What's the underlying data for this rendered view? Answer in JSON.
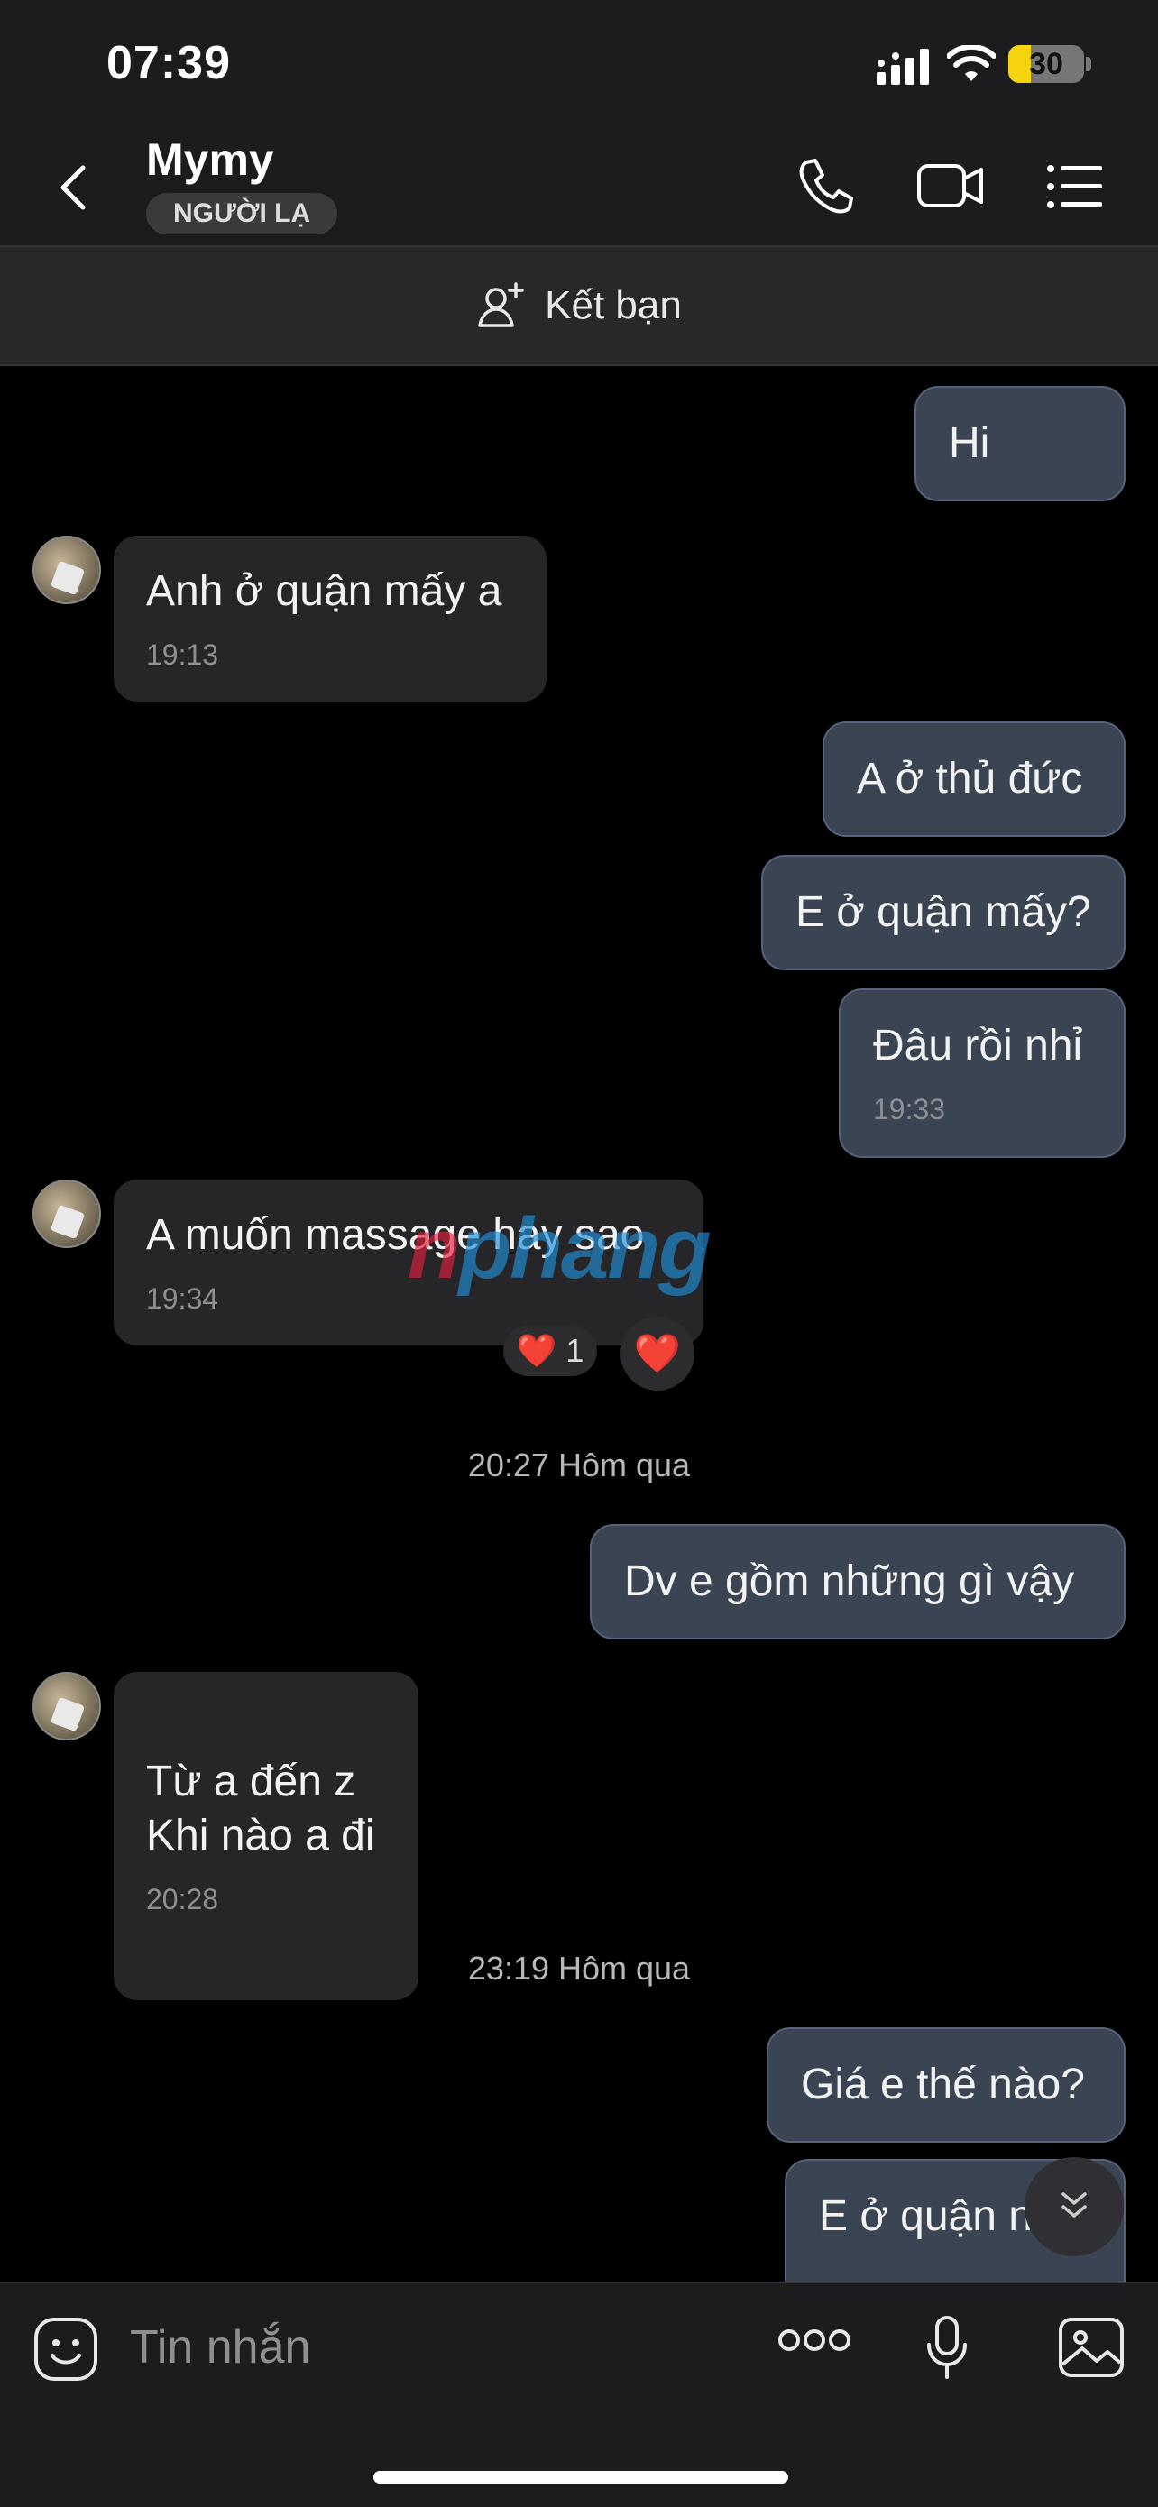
{
  "status_bar": {
    "time": "07:39",
    "battery_level": "30",
    "battery_fraction": 0.3
  },
  "header": {
    "contact_name": "Mymy",
    "badge": "NGƯỜI LẠ"
  },
  "add_friend": {
    "label": "Kết bạn"
  },
  "messages": [
    {
      "direction": "out",
      "text": "Hi"
    },
    {
      "direction": "in",
      "text": "Anh ở quận mấy a",
      "time": "19:13"
    },
    {
      "direction": "out",
      "text": "A ở thủ đức"
    },
    {
      "direction": "out",
      "text": "E ở quận mấy?"
    },
    {
      "direction": "out",
      "text": "Đâu rồi nhỉ",
      "time": "19:33"
    },
    {
      "direction": "in",
      "text": "A muốn massage hay sao",
      "time": "19:34",
      "reaction": {
        "emoji": "❤️",
        "count": "1"
      },
      "react_button": "❤️"
    },
    {
      "direction": "out",
      "text": "Dv e gồm những gì vậy"
    },
    {
      "direction": "in",
      "text": "Từ a đến z\nKhi nào a đi",
      "time": "20:28"
    },
    {
      "direction": "out",
      "text": "Giá e thế nào?"
    },
    {
      "direction": "out",
      "text": "E ở quận n"
    }
  ],
  "date_separators": [
    "20:27 Hôm qua",
    "23:19 Hôm qua"
  ],
  "watermark": {
    "part1": "n",
    "part2": "phang"
  },
  "input": {
    "placeholder": "Tin nhắn"
  },
  "colors": {
    "outgoing_bubble": "#3a4453",
    "incoming_bubble": "#262628",
    "battery": "#f5d40e",
    "background": "#000000"
  }
}
